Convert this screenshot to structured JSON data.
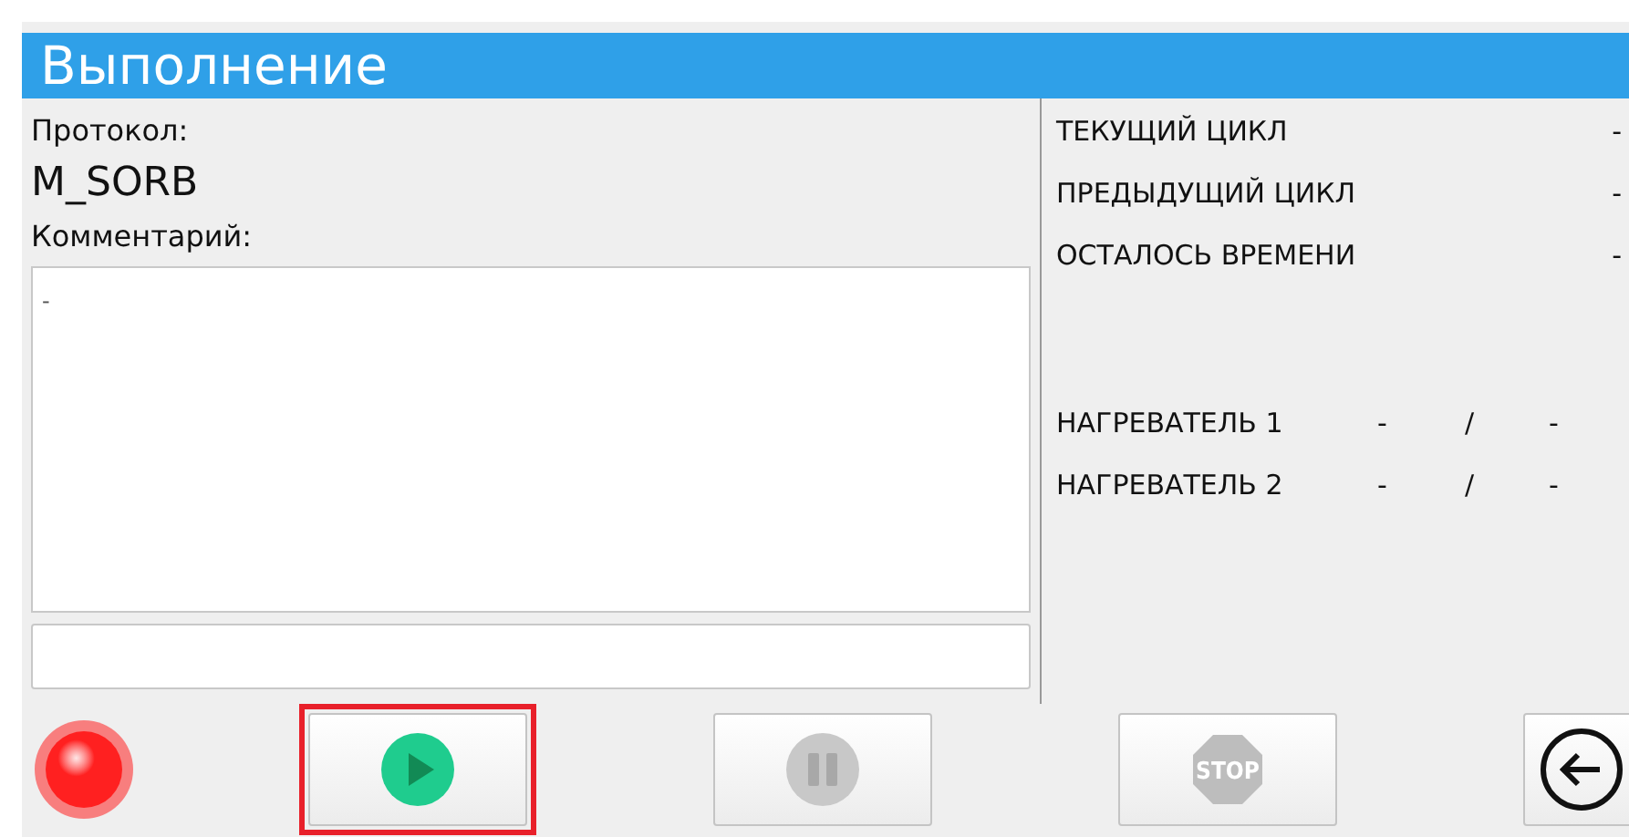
{
  "window": {
    "title": "Выполнение"
  },
  "protocol": {
    "label": "Протокол:",
    "value": "M_SORB"
  },
  "comment": {
    "label": "Комментарий:",
    "value": "-"
  },
  "status": [
    {
      "label": "ТЕКУЩИЙ ЦИКЛ",
      "value": "-"
    },
    {
      "label": "ПРЕДЫДУЩИЙ ЦИКЛ",
      "value": "-"
    },
    {
      "label": "ОСТАЛОСЬ ВРЕМЕНИ",
      "value": "-"
    }
  ],
  "heaters": [
    {
      "label": "НАГРЕВАТЕЛЬ 1",
      "current": "-",
      "separator": "/",
      "target": "-"
    },
    {
      "label": "НАГРЕВАТЕЛЬ 2",
      "current": "-",
      "separator": "/",
      "target": "-"
    }
  ],
  "indicator": {
    "color": "#ff2020"
  },
  "buttons": [
    {
      "kind": "play",
      "selected": true,
      "disabled": false
    },
    {
      "kind": "pause",
      "selected": false,
      "disabled": true
    },
    {
      "kind": "stop",
      "label": "STOP",
      "selected": false,
      "disabled": true
    },
    {
      "kind": "back",
      "selected": false,
      "disabled": false
    }
  ]
}
